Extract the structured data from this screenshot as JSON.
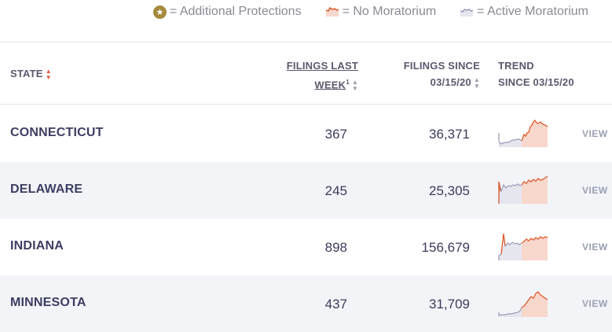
{
  "legend": {
    "additional": "= Additional Protections",
    "no_moratorium": "= No Moratorium",
    "active_moratorium": "= Active Moratorium"
  },
  "header": {
    "state": "STATE",
    "filings_last_line1": "FILINGS LAST",
    "filings_last_line2": "WEEK",
    "filings_last_sup": "1",
    "filings_since_line1": "FILINGS SINCE",
    "filings_since_line2": "03/15/20",
    "trend_line1": "TREND",
    "trend_line2": "SINCE 03/15/20"
  },
  "colors": {
    "no_moratorium": "#e05a2b",
    "no_moratorium_fill": "#f8d7cc",
    "active_moratorium": "#9a9ab8",
    "active_moratorium_fill": "#e6e6ee",
    "star": "#a58a3e"
  },
  "rows": [
    {
      "state": "CONNECTICUT",
      "filings_last_week": "367",
      "filings_since": "36,371",
      "view": "VIEW"
    },
    {
      "state": "DELAWARE",
      "filings_last_week": "245",
      "filings_since": "25,305",
      "view": "VIEW"
    },
    {
      "state": "INDIANA",
      "filings_last_week": "898",
      "filings_since": "156,679",
      "view": "VIEW"
    },
    {
      "state": "MINNESOTA",
      "filings_last_week": "437",
      "filings_since": "31,709",
      "view": "VIEW"
    }
  ]
}
